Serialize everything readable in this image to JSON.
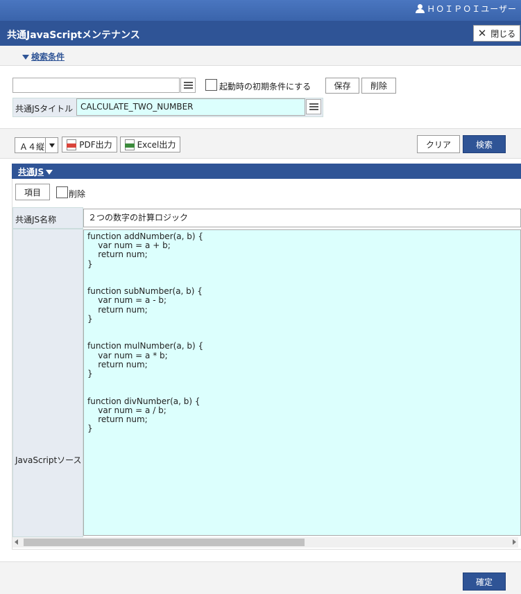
{
  "header": {
    "user_name": "ＨＯＩＰＯＩユーザー",
    "page_title": "共通JavaScriptメンテナンス",
    "close_label": "閉じる"
  },
  "search": {
    "toggle_label": "検索条件",
    "condition_value": "",
    "startup_default_label": "起動時の初期条件にする",
    "save_label": "保存",
    "delete_label": "削除",
    "title_field_label": "共通JSタイトル",
    "title_field_value": "CALCULATE_TWO_NUMBER"
  },
  "toolbar": {
    "paper_size": "Ａ４縦",
    "pdf_label": "PDF出力",
    "excel_label": "Excel出力",
    "clear_label": "クリア",
    "search_label": "検索",
    "pdf_icon_color": "#d9443b",
    "excel_icon_color": "#3d8b3d"
  },
  "section": {
    "title": "共通JS",
    "item_button_label": "項目",
    "delete_check_label": "削除",
    "name_label": "共通JS名称",
    "name_value": "２つの数字の計算ロジック",
    "source_label": "JavaScriptソース",
    "source_code": "function addNumber(a, b) {\n    var num = a + b;\n    return num;\n}\n\n\nfunction subNumber(a, b) {\n    var num = a - b;\n    return num;\n}\n\n\nfunction mulNumber(a, b) {\n    var num = a * b;\n    return num;\n}\n\n\nfunction divNumber(a, b) {\n    var num = a / b;\n    return num;\n}"
  },
  "footer": {
    "confirm_label": "確定"
  },
  "colors": {
    "primary": "#2f5496",
    "input_highlight": "#dcfffd",
    "label_bg": "#e6ebf2"
  }
}
